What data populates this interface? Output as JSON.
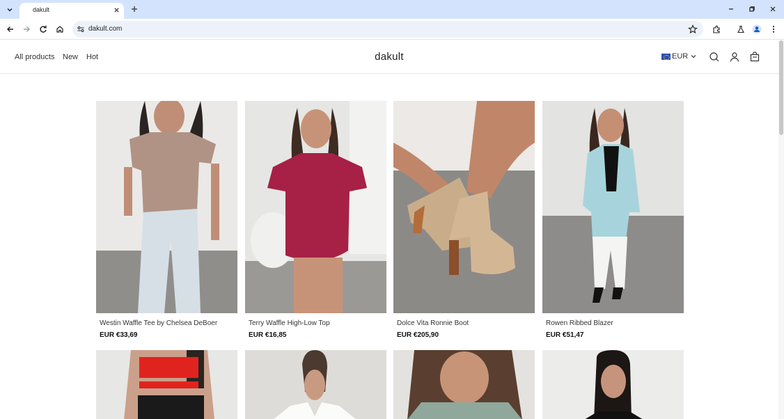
{
  "browser": {
    "tab_title": "dakult",
    "url": "dakult.com"
  },
  "nav": {
    "links": [
      {
        "label": "All products"
      },
      {
        "label": "New"
      },
      {
        "label": "Hot"
      }
    ]
  },
  "brand": "dakult",
  "currency": "EUR",
  "products": [
    {
      "name": "Westin Waffle Tee by Chelsea DeBoer",
      "price": "EUR €33,69"
    },
    {
      "name": "Terry Waffle High-Low Top",
      "price": "EUR €16,85"
    },
    {
      "name": "Dolce Vita Ronnie Boot",
      "price": "EUR €205,90"
    },
    {
      "name": "Rowen Ribbed Blazer",
      "price": "EUR €51,47"
    }
  ]
}
